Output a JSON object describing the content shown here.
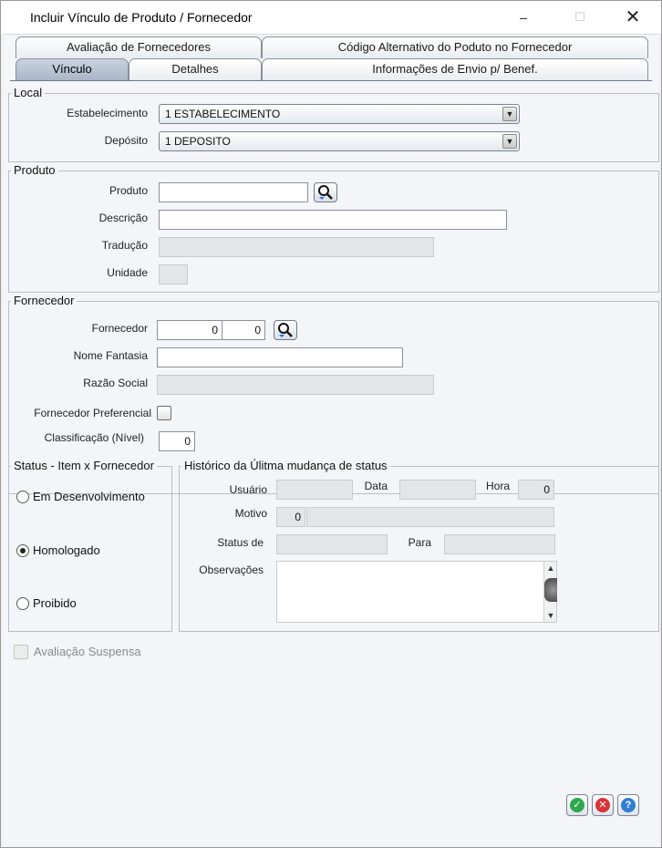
{
  "window": {
    "title": "Incluir Vínculo de Produto / Fornecedor",
    "minimize": "–",
    "maximize": "☐",
    "close": "✕"
  },
  "tabs": {
    "row1": [
      "Avaliação de Fornecedores",
      "Código Alternativo do Poduto no Fornecedor"
    ],
    "row2": [
      "Vínculo",
      "Detalhes",
      "Informações de Envio p/ Benef."
    ],
    "active": "Vínculo"
  },
  "local": {
    "legend": "Local",
    "estabelecimento_label": "Estabelecimento",
    "estabelecimento_value": "1 ESTABELECIMENTO",
    "deposito_label": "Depósito",
    "deposito_value": "1 DEPOSITO"
  },
  "produto": {
    "legend": "Produto",
    "produto_label": "Produto",
    "produto_value": "",
    "descricao_label": "Descrição",
    "descricao_value": "",
    "traducao_label": "Tradução",
    "unidade_label": "Unidade"
  },
  "fornecedor": {
    "legend": "Fornecedor",
    "fornecedor_label": "Fornecedor",
    "fornecedor_code": "0",
    "fornecedor_seq": "0",
    "nome_fantasia_label": "Nome Fantasia",
    "nome_fantasia_value": "",
    "razao_social_label": "Razão Social",
    "preferencial_label": "Fornecedor Preferencial",
    "classificacao_label": "Classificação (Nível)",
    "classificacao_value": "0"
  },
  "status": {
    "legend": "Status - Item x Fornecedor",
    "options": [
      "Em Desenvolvimento",
      "Homologado",
      "Proibido"
    ],
    "selected": "Homologado"
  },
  "historico": {
    "legend": "Histórico da Úlitma mudança de status",
    "usuario_label": "Usuário",
    "data_label": "Data",
    "hora_label": "Hora",
    "hora_value": "0",
    "motivo_label": "Motivo",
    "motivo_code": "0",
    "status_de_label": "Status de",
    "para_label": "Para",
    "observacoes_label": "Observações"
  },
  "avaliacao_suspensa_label": "Avaliação Suspensa",
  "icons": {
    "lookup": "magnifier-icon",
    "ok": "check-icon",
    "cancel": "cancel-icon",
    "help": "help-icon"
  },
  "colors": {
    "ok": "#2fa84f",
    "cancel": "#d9343a",
    "help": "#2f7fd1"
  }
}
